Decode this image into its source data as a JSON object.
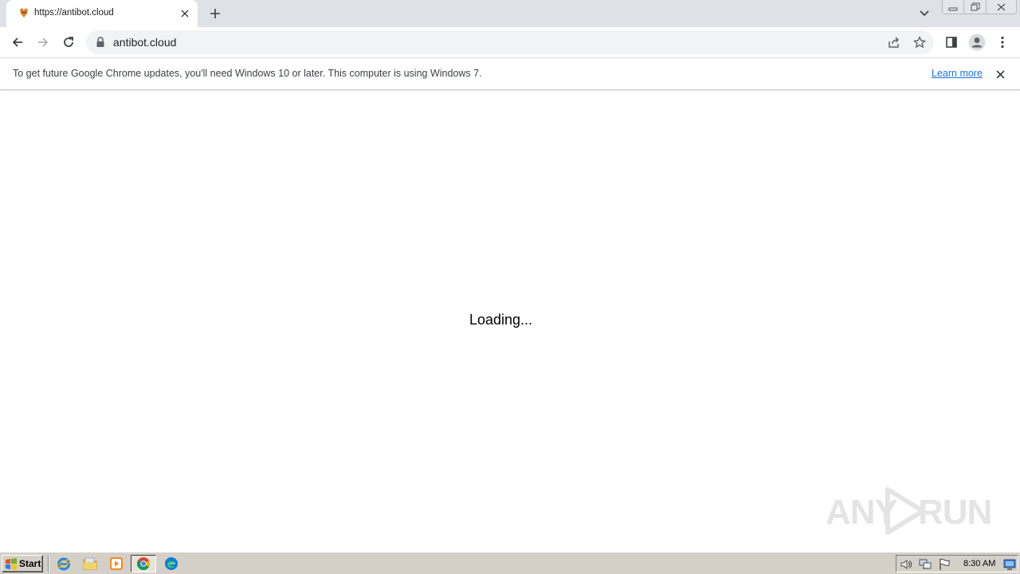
{
  "browser": {
    "tab": {
      "title": "https://antibot.cloud"
    },
    "address_bar": {
      "url": "antibot.cloud"
    }
  },
  "infobar": {
    "message": "To get future Google Chrome updates, you'll need Windows 10 or later. This computer is using Windows 7.",
    "link_label": "Learn more"
  },
  "page": {
    "loading_text": "Loading..."
  },
  "watermark": {
    "left": "ANY",
    "right": "RUN"
  },
  "taskbar": {
    "start_label": "Start",
    "clock": "8:30 AM"
  },
  "colors": {
    "tabstrip_bg": "#dee1e6",
    "omnibox_bg": "#f1f3f4",
    "link": "#1a73e8",
    "taskbar_bg": "#d4d0c8"
  },
  "icons": [
    "favicon-icon",
    "close-icon",
    "plus-icon",
    "chevron-down-icon",
    "minimize-icon",
    "restore-icon",
    "back-arrow-icon",
    "forward-arrow-icon",
    "reload-icon",
    "lock-icon",
    "share-icon",
    "star-icon",
    "side-panel-icon",
    "profile-icon",
    "kebab-menu-icon",
    "windows-flag-icon",
    "ie-icon",
    "folder-icon",
    "media-player-icon",
    "chrome-icon",
    "edge-icon",
    "speaker-icon",
    "network-icon",
    "flag-icon",
    "show-desktop-icon"
  ]
}
